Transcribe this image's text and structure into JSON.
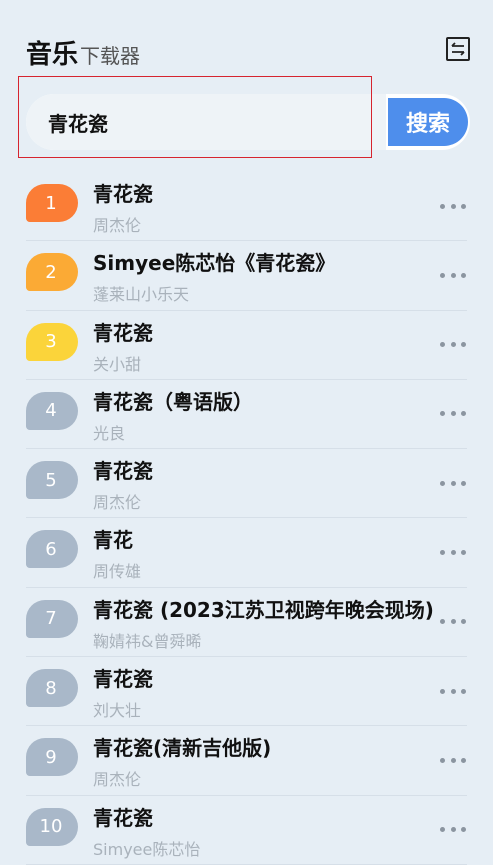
{
  "header": {
    "title_main": "音乐",
    "title_sub": "下载器",
    "switch_icon": "switch-arrows-icon"
  },
  "search": {
    "value": "青花瓷",
    "button_label": "搜索"
  },
  "colors": {
    "rank1": "#fb7d36",
    "rank2": "#fbaa35",
    "rank3": "#fbd43a",
    "rank_default": "#a9b8c9",
    "search_button": "#4e8eec"
  },
  "results": [
    {
      "rank": "1",
      "title": "青花瓷",
      "artist": "周杰伦"
    },
    {
      "rank": "2",
      "title": "Simyee陈芯怡《青花瓷》",
      "artist": "蓬莱山小乐天"
    },
    {
      "rank": "3",
      "title": "青花瓷",
      "artist": "关小甜"
    },
    {
      "rank": "4",
      "title": "青花瓷（粤语版）",
      "artist": "光良"
    },
    {
      "rank": "5",
      "title": "青花瓷",
      "artist": "周杰伦"
    },
    {
      "rank": "6",
      "title": "青花",
      "artist": "周传雄"
    },
    {
      "rank": "7",
      "title": "青花瓷 (2023江苏卫视跨年晚会现场)",
      "artist": "鞠婧祎&曾舜晞"
    },
    {
      "rank": "8",
      "title": "青花瓷",
      "artist": "刘大壮"
    },
    {
      "rank": "9",
      "title": "青花瓷(清新吉他版)",
      "artist": "周杰伦"
    },
    {
      "rank": "10",
      "title": "青花瓷",
      "artist": "Simyee陈芯怡"
    }
  ]
}
